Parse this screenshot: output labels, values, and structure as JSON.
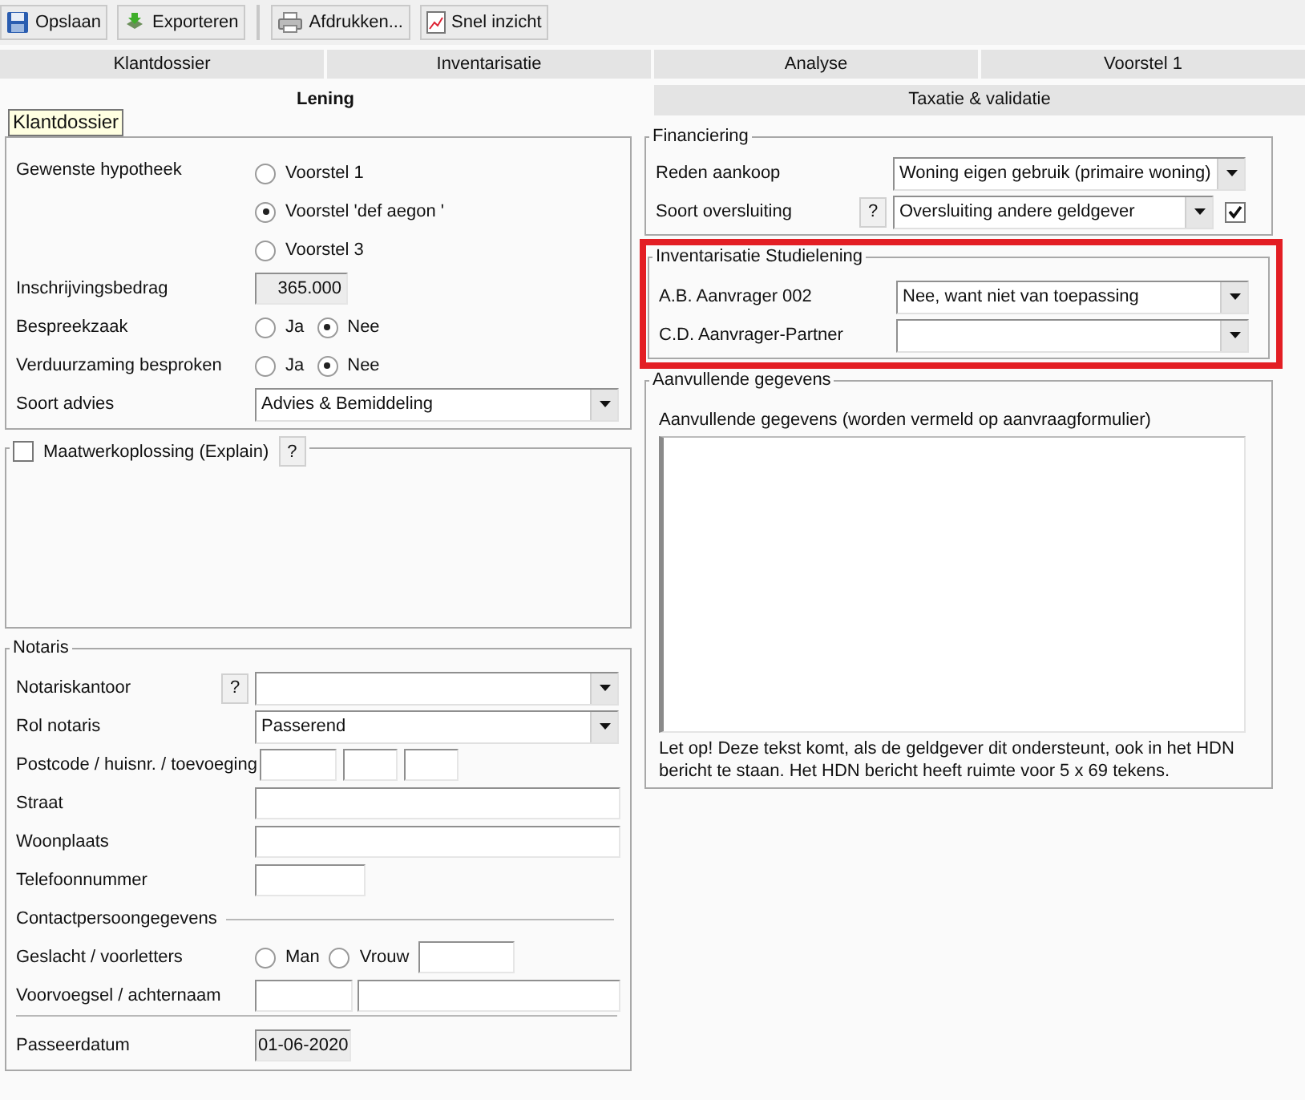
{
  "toolbar": [
    {
      "label": "Opslaan",
      "kind": "save",
      "separator_before": false
    },
    {
      "label": "Exporteren",
      "kind": "export",
      "separator_before": false
    },
    {
      "label": "Afdrukken...",
      "kind": "print",
      "separator_before": true
    },
    {
      "label": "Snel inzicht",
      "kind": "report",
      "separator_before": false
    }
  ],
  "tabs": [
    [
      {
        "label": "Klantdossier",
        "selected": false
      },
      {
        "label": "Inventarisatie",
        "selected": false
      },
      {
        "label": "Analyse",
        "selected": false
      },
      {
        "label": "Voorstel 1",
        "selected": false
      }
    ],
    [
      {
        "label": "Lening",
        "selected": true
      },
      {
        "label": "Taxatie & validatie",
        "selected": false
      }
    ]
  ],
  "tooltip": "Klantdossier",
  "lening": {
    "rows": [
      {
        "kind": "radio-stack",
        "label": "Gewenste hypotheek",
        "options": [
          {
            "label": "Voorstel 1",
            "selected": false
          },
          {
            "label": "Voorstel 'def aegon '",
            "selected": true
          },
          {
            "label": "Voorstel 3",
            "selected": false
          }
        ]
      },
      {
        "kind": "amount",
        "label": "Inschrijvingsbedrag",
        "value": "365.000"
      },
      {
        "kind": "radio-inline",
        "label": "Bespreekzaak",
        "options": [
          {
            "label": "Ja",
            "selected": false
          },
          {
            "label": "Nee",
            "selected": true
          }
        ]
      },
      {
        "kind": "radio-inline",
        "label": "Verduurzaming besproken",
        "options": [
          {
            "label": "Ja",
            "selected": false
          },
          {
            "label": "Nee",
            "selected": true
          }
        ]
      },
      {
        "kind": "select",
        "label": "Soort advies",
        "value": "Advies & Bemiddeling"
      }
    ]
  },
  "maatwerk": {
    "label": "Maatwerkoplossing (Explain)",
    "checked": false,
    "help": "?"
  },
  "notaris": {
    "legend": "Notaris",
    "rows": [
      {
        "kind": "select",
        "label": "Notariskantoor",
        "help": "?"
      },
      {
        "kind": "select",
        "label": "Rol notaris",
        "value": "Passerend"
      },
      {
        "kind": "postcode",
        "label": "Postcode / huisnr. / toevoeging"
      },
      {
        "kind": "text",
        "label": "Straat"
      },
      {
        "kind": "text",
        "label": "Woonplaats"
      },
      {
        "kind": "short",
        "label": "Telefoonnummer"
      },
      {
        "kind": "heading",
        "label": "Contactpersoongegevens"
      },
      {
        "kind": "gender",
        "label": "Geslacht / voorletters",
        "options": [
          {
            "label": "Man",
            "selected": false
          },
          {
            "label": "Vrouw",
            "selected": false
          }
        ]
      },
      {
        "kind": "name",
        "label": "Voorvoegsel / achternaam"
      },
      {
        "kind": "divider"
      },
      {
        "kind": "date",
        "label": "Passeerdatum",
        "value": "01-06-2020"
      }
    ]
  },
  "financiering": {
    "legend": "Financiering",
    "rows": [
      {
        "kind": "select",
        "label": "Reden aankoop",
        "value": "Woning eigen gebruik (primaire woning)"
      },
      {
        "kind": "select",
        "label": "Soort oversluiting",
        "help": "?",
        "value": "Oversluiting andere geldgever",
        "checked": true
      }
    ]
  },
  "studielening": {
    "legend": "Inventarisatie Studielening",
    "highlighted": true,
    "rows": [
      {
        "kind": "select",
        "label": "A.B. Aanvrager 002",
        "value": "Nee, want niet van toepassing"
      },
      {
        "kind": "select",
        "label": "C.D. Aanvrager-Partner"
      }
    ]
  },
  "aanvullend": {
    "legend": "Aanvullende gegevens",
    "field_label": "Aanvullende gegevens (worden vermeld op aanvraagformulier)",
    "note": "Let op! Deze tekst komt, als de geldgever dit ondersteunt, ook in het HDN bericht te staan. Het HDN bericht heeft ruimte voor 5 x 69 tekens."
  }
}
